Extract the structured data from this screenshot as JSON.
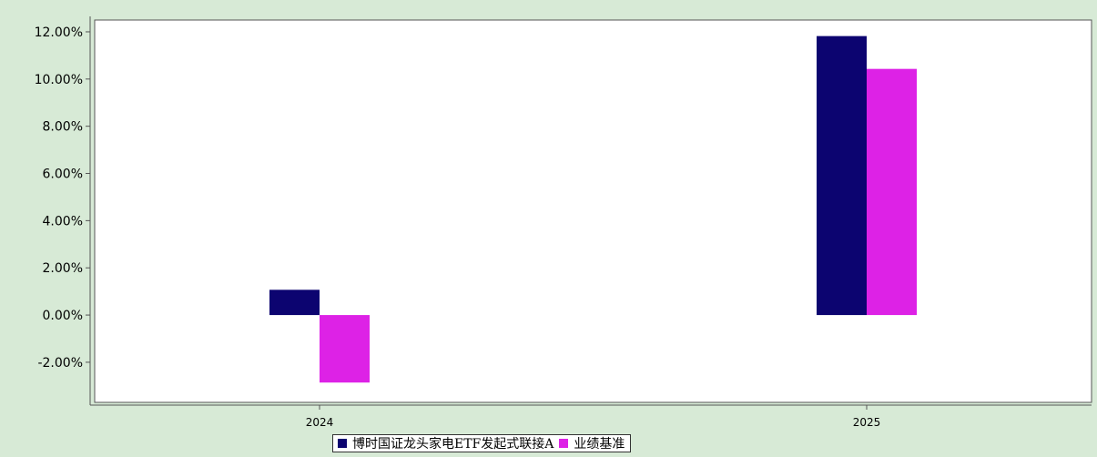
{
  "chart_data": {
    "type": "bar",
    "title": "",
    "xlabel": "",
    "ylabel": "",
    "categories": [
      "2024",
      "2025"
    ],
    "series": [
      {
        "name": "博时国证龙头家电ETF发起式联接A",
        "values": [
          1.07,
          11.82
        ],
        "color": "#0c0470"
      },
      {
        "name": "业绩基准",
        "values": [
          -2.86,
          10.43
        ],
        "color": "#dd22e6"
      }
    ],
    "ylim": [
      -3.7,
      12.5
    ],
    "yticks": [
      -2,
      0,
      2,
      4,
      6,
      8,
      10,
      12
    ],
    "ytick_labels": [
      "-2.00%",
      "0.00%",
      "2.00%",
      "4.00%",
      "6.00%",
      "8.00%",
      "10.00%",
      "12.00%"
    ],
    "grid": false,
    "legend_position": "bottom-center",
    "background_color": "#d7ead6",
    "plot_background_color": "#ffffff"
  }
}
